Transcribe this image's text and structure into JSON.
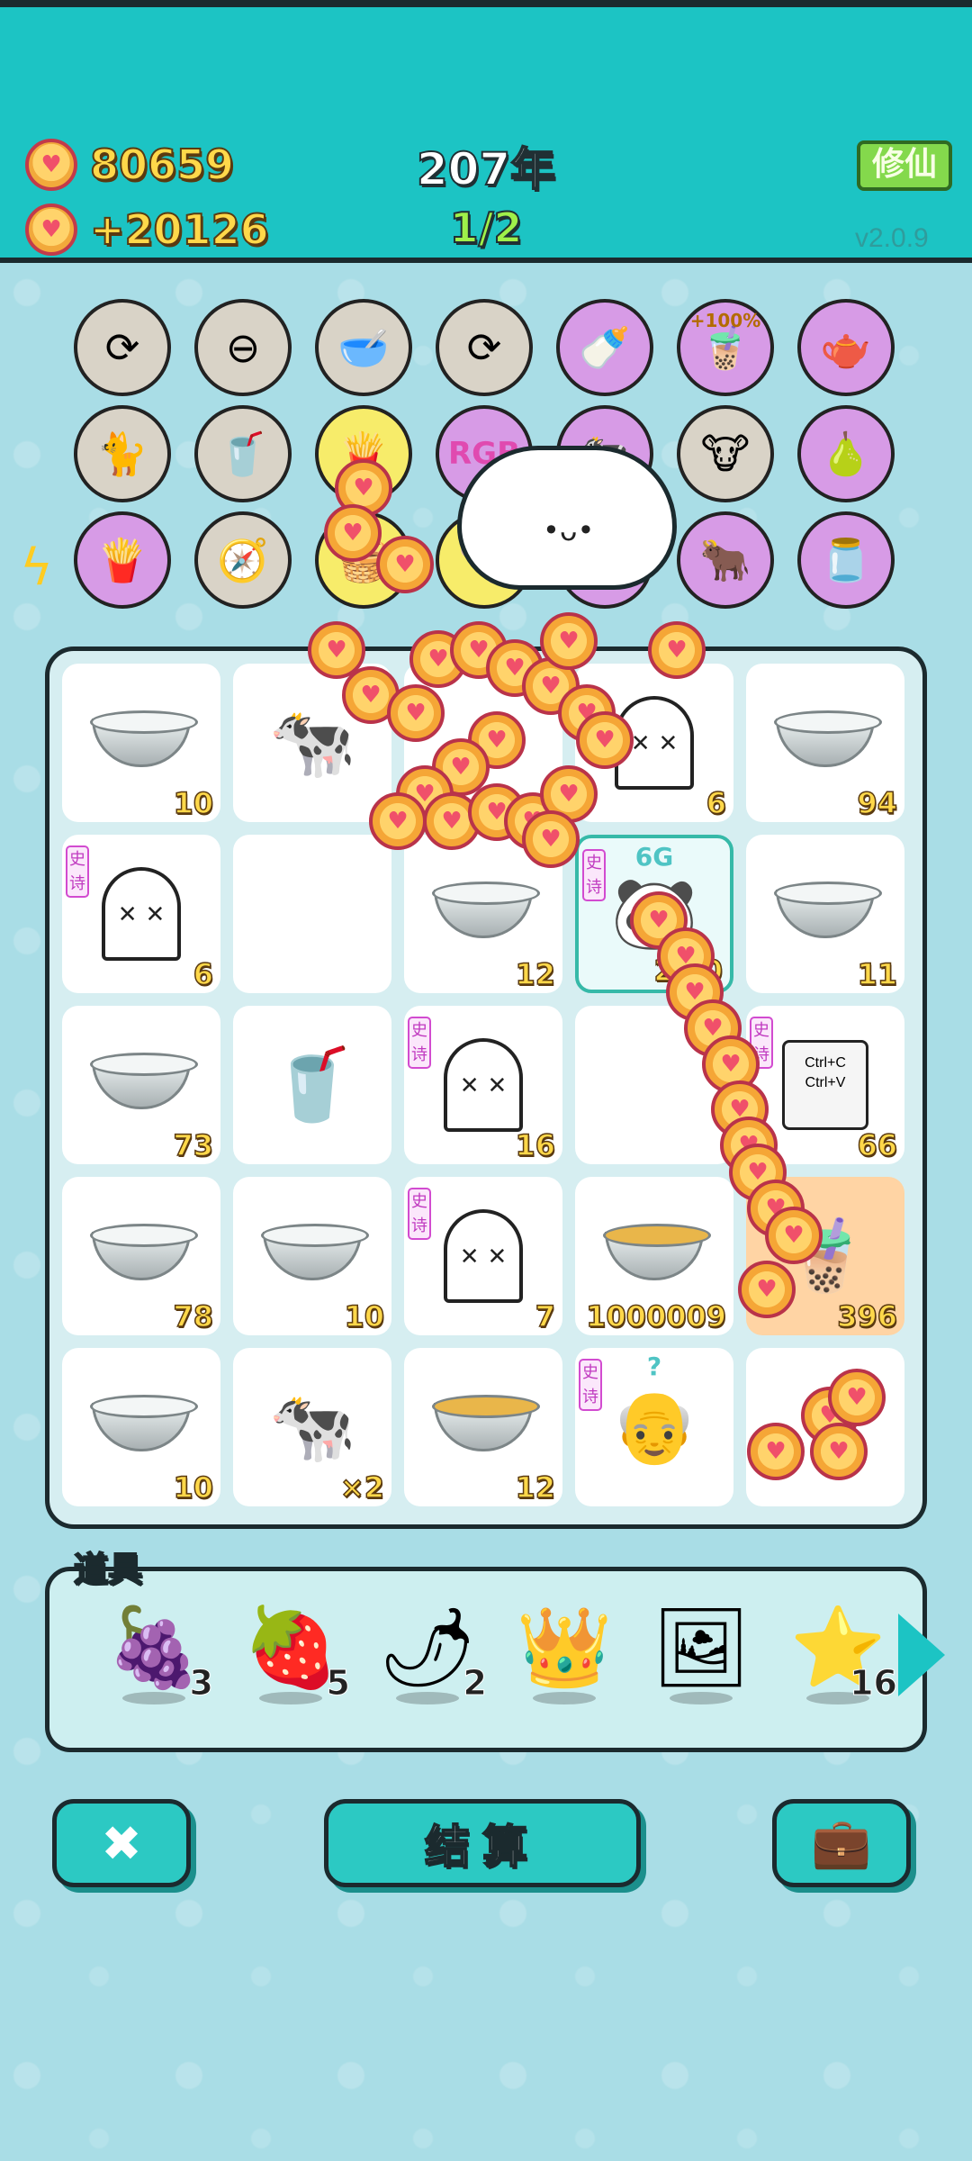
{
  "header": {
    "coins": "80659",
    "income": "+20126",
    "year": "207年",
    "stage": "1/2",
    "xiuxian_label": "修仙",
    "version": "v2.0.9"
  },
  "skills": [
    {
      "icon": "refresh-icon",
      "glyph": "⟳",
      "color": "gray"
    },
    {
      "icon": "no-entry-icon",
      "glyph": "⊖",
      "color": "gray"
    },
    {
      "icon": "pet-bowl-icon",
      "glyph": "🥣",
      "color": "gray"
    },
    {
      "icon": "refresh-icon",
      "glyph": "⟳",
      "color": "gray"
    },
    {
      "icon": "milk-bottle-icon",
      "glyph": "🍼",
      "color": "purple"
    },
    {
      "icon": "boost-100-icon",
      "glyph": "🧋",
      "color": "purple",
      "label": "+100%"
    },
    {
      "icon": "gravy-boat-icon",
      "glyph": "🫖",
      "color": "purple"
    },
    {
      "icon": "cat-icon",
      "glyph": "🐈",
      "color": "gray"
    },
    {
      "icon": "cup-icon",
      "glyph": "🥤",
      "color": "gray"
    },
    {
      "icon": "fries-icon",
      "glyph": "🍟",
      "color": "yellow"
    },
    {
      "icon": "rgb-icon",
      "glyph": "RGB",
      "color": "purple"
    },
    {
      "icon": "cow-icon",
      "glyph": "🐄",
      "color": "purple"
    },
    {
      "icon": "twin-cows-icon",
      "glyph": "🐮",
      "color": "gray"
    },
    {
      "icon": "pomelo-icon",
      "glyph": "🍐",
      "color": "purple"
    },
    {
      "icon": "fries-icon",
      "glyph": "🍟",
      "color": "purple"
    },
    {
      "icon": "compass-icon",
      "glyph": "🧭",
      "color": "gray"
    },
    {
      "icon": "fruit-basket-icon",
      "glyph": "🧺",
      "color": "yellow"
    },
    {
      "icon": "bone-icon",
      "glyph": "🦴",
      "color": "yellow"
    },
    {
      "icon": "milk-carton-icon",
      "glyph": "🥛",
      "color": "purple"
    },
    {
      "icon": "cow-card-icon",
      "glyph": "🐂",
      "color": "purple"
    },
    {
      "icon": "jar-icon",
      "glyph": "🫙",
      "color": "purple"
    }
  ],
  "board": {
    "cells": [
      {
        "item": "bowl",
        "count": "10"
      },
      {
        "item": "cow",
        "count": ""
      },
      {
        "item": "coins",
        "count": ""
      },
      {
        "item": "ghost",
        "count": "6"
      },
      {
        "item": "bowl",
        "count": "94"
      },
      {
        "item": "ghost",
        "count": "6",
        "tag": "史诗"
      },
      {
        "item": "empty",
        "count": ""
      },
      {
        "item": "bowl-ball",
        "count": "12"
      },
      {
        "item": "panda",
        "count": "2…0",
        "tag": "史诗",
        "label": "6G",
        "selected": true
      },
      {
        "item": "bowl",
        "count": "11"
      },
      {
        "item": "bowl",
        "count": "73"
      },
      {
        "item": "cup",
        "count": ""
      },
      {
        "item": "ghost",
        "count": "16",
        "tag": "史诗"
      },
      {
        "item": "empty",
        "count": ""
      },
      {
        "item": "ctrl",
        "count": "66",
        "tag": "史诗",
        "text1": "Ctrl+C",
        "text2": "Ctrl+V"
      },
      {
        "item": "bowl",
        "count": "78"
      },
      {
        "item": "bowl",
        "count": "10"
      },
      {
        "item": "ghost",
        "count": "7",
        "tag": "史诗"
      },
      {
        "item": "bowl-soup",
        "count": "1000009"
      },
      {
        "item": "bubble-tea",
        "count": "396",
        "orange": true
      },
      {
        "item": "bowl",
        "count": "10"
      },
      {
        "item": "cow",
        "count": "×2"
      },
      {
        "item": "bowl-soup",
        "count": "12"
      },
      {
        "item": "farmer",
        "count": "",
        "tag": "史诗",
        "label": "?"
      },
      {
        "item": "coins",
        "count": ""
      }
    ]
  },
  "props": {
    "title": "道具",
    "items": [
      {
        "icon": "bayberry-icon",
        "glyph": "🍇",
        "count": "3"
      },
      {
        "icon": "strawberry-icon",
        "glyph": "🍓",
        "count": "5"
      },
      {
        "icon": "pepper-icon",
        "glyph": "🌶",
        "count": "2"
      },
      {
        "icon": "crown-icon",
        "glyph": "👑",
        "count": ""
      },
      {
        "icon": "frame-icon",
        "glyph": "🖼",
        "count": ""
      },
      {
        "icon": "star-icon",
        "glyph": "⭐",
        "count": "16"
      }
    ]
  },
  "buttons": {
    "exit_icon": "✖",
    "settle_label": "结算",
    "bag_icon": "💼"
  },
  "colors": {
    "header": "#1cc4c4",
    "background": "#a9dde6",
    "coin": "#ffd36b"
  }
}
